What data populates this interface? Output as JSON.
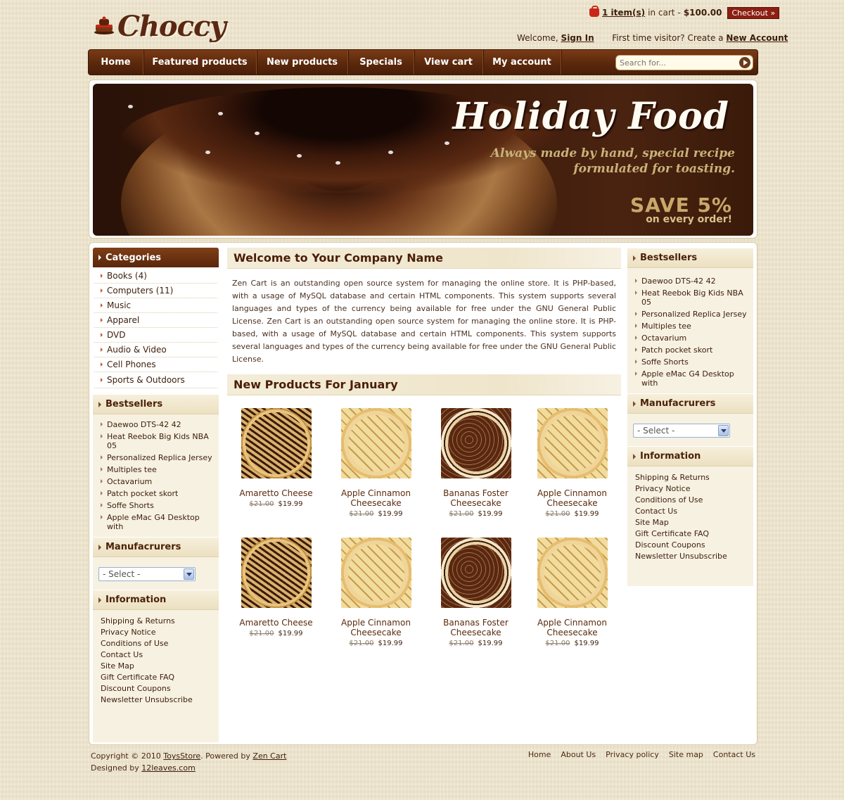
{
  "header": {
    "logo_text": "Choccy",
    "cart": {
      "items": "1 item(s)",
      "in_cart": "in cart",
      "sep": " - ",
      "total": "$100.00",
      "checkout": "Checkout »"
    },
    "welcome": {
      "prefix": "Welcome,",
      "sign_in": "Sign In",
      "visitor": "First time visitor? Create a",
      "new_account": "New Account"
    }
  },
  "nav": {
    "items": [
      "Home",
      "Featured products",
      "New products",
      "Specials",
      "View cart",
      "My account"
    ],
    "search_placeholder": "Search for..."
  },
  "banner": {
    "title": "Holiday Food",
    "tagline_1": "Always made by hand, special recipe",
    "tagline_2": "formulated for toasting.",
    "save": "SAVE 5%",
    "save_sub": "on every order!"
  },
  "left": {
    "categories_title": "Categories",
    "categories": [
      "Books (4)",
      "Computers (11)",
      "Music",
      "Apparel",
      "DVD",
      "Audio & Video",
      "Cell Phones",
      "Sports & Outdoors"
    ],
    "bestsellers_title": "Bestsellers",
    "bestsellers": [
      "Daewoo DTS-42 42",
      "Heat Reebok Big Kids NBA 05",
      "Personalized Replica Jersey",
      "Multiples tee",
      "Octavarium",
      "Patch pocket skort",
      "Soffe Shorts",
      "Apple eMac G4 Desktop with"
    ],
    "manufacturers_title": "Manufacrurers",
    "select_value": "- Select -",
    "information_title": "Information",
    "information": [
      "Shipping & Returns",
      "Privacy Notice",
      "Conditions of Use",
      "Contact Us",
      "Site Map",
      "Gift Certificate FAQ",
      "Discount Coupons",
      "Newsletter Unsubscribe"
    ]
  },
  "center": {
    "welcome_title": "Welcome to Your Company Name",
    "welcome_text": "Zen Cart is an outstanding open source system for managing the online store. It is PHP-based, with a usage of MySQL database and certain HTML components. This system supports several languages and types of the currency being available for free under the GNU General Public License. Zen Cart is an outstanding open source system for managing the online store. It is PHP-based, with a usage of MySQL database and certain HTML components. This system supports several languages and types of the currency being available for free under the GNU General Public License.",
    "new_products_title": "New Products For January",
    "products": [
      {
        "name_1": "Amaretto Cheese",
        "name_2": "",
        "old": "$21.00",
        "price": "$19.99",
        "img": "amaretto-cheese-image"
      },
      {
        "name_1": "Apple Cinnamon",
        "name_2": "Cheesecake",
        "old": "$21.00",
        "price": "$19.99",
        "img": "apple-cinnamon-image"
      },
      {
        "name_1": "Bananas Foster",
        "name_2": "Cheesecake",
        "old": "$21.00",
        "price": "$19.99",
        "img": "bananas-foster-image"
      },
      {
        "name_1": "Apple Cinnamon",
        "name_2": "Cheesecake",
        "old": "$21.00",
        "price": "$19.99",
        "img": "apple-cinnamon-image"
      },
      {
        "name_1": "Amaretto Cheese",
        "name_2": "",
        "old": "$21.00",
        "price": "$19.99",
        "img": "amaretto-cheese-image"
      },
      {
        "name_1": "Apple Cinnamon",
        "name_2": "Cheesecake",
        "old": "$21.00",
        "price": "$19.99",
        "img": "apple-cinnamon-image"
      },
      {
        "name_1": "Bananas Foster",
        "name_2": "Cheesecake",
        "old": "$21.00",
        "price": "$19.99",
        "img": "bananas-foster-image"
      },
      {
        "name_1": "Apple Cinnamon",
        "name_2": "Cheesecake",
        "old": "$21.00",
        "price": "$19.99",
        "img": "apple-cinnamon-image"
      }
    ]
  },
  "right": {
    "bestsellers_title": "Bestsellers",
    "bestsellers": [
      "Daewoo DTS-42 42",
      "Heat Reebok Big Kids NBA 05",
      "Personalized Replica Jersey",
      "Multiples tee",
      "Octavarium",
      "Patch pocket skort",
      "Soffe Shorts",
      "Apple eMac G4 Desktop with"
    ],
    "manufacturers_title": "Manufacrurers",
    "select_value": "- Select -",
    "information_title": "Information",
    "information": [
      "Shipping & Returns",
      "Privacy Notice",
      "Conditions of Use",
      "Contact Us",
      "Site Map",
      "Gift Certificate FAQ",
      "Discount Coupons",
      "Newsletter Unsubscribe"
    ]
  },
  "footer": {
    "copyright_prefix": "Copyright © 2010",
    "store": "ToysStore",
    "powered": ". Powered by",
    "zencart": "Zen Cart",
    "designed": "Designed by",
    "designer": "12leaves.com",
    "links": [
      "Home",
      "About Us",
      "Privacy policy",
      "Site map",
      "Contact Us"
    ]
  },
  "colors": {
    "brand_brown": "#5a260b",
    "page_bg": "#efe5cd",
    "checkout_red": "#8c1f12"
  }
}
